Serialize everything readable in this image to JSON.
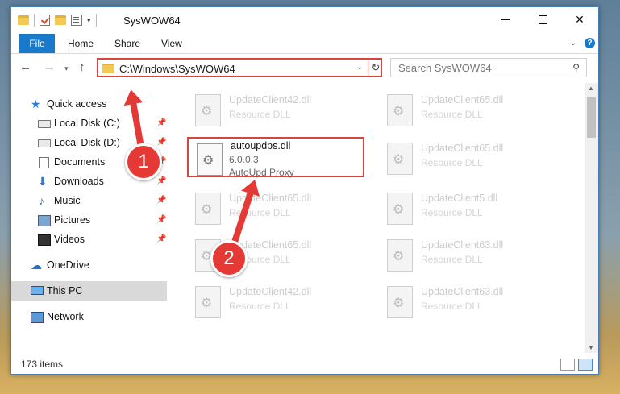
{
  "window": {
    "title": "SysWOW64"
  },
  "ribbon": {
    "tabs": [
      "File",
      "Home",
      "Share",
      "View"
    ]
  },
  "address": {
    "path": "C:\\Windows\\SysWOW64"
  },
  "search": {
    "placeholder": "Search SysWOW64"
  },
  "sidebar": {
    "items": [
      {
        "label": "Quick access",
        "icon": "star-icon",
        "pinned": false
      },
      {
        "label": "Local Disk (C:)",
        "icon": "disk-icon",
        "pinned": true
      },
      {
        "label": "Local Disk (D:)",
        "icon": "disk-icon",
        "pinned": true
      },
      {
        "label": "Documents",
        "icon": "document-icon",
        "pinned": true
      },
      {
        "label": "Downloads",
        "icon": "download-icon",
        "pinned": true
      },
      {
        "label": "Music",
        "icon": "music-icon",
        "pinned": true
      },
      {
        "label": "Pictures",
        "icon": "picture-icon",
        "pinned": true
      },
      {
        "label": "Videos",
        "icon": "video-icon",
        "pinned": true
      },
      {
        "label": "OneDrive",
        "icon": "cloud-icon",
        "pinned": false
      },
      {
        "label": "This PC",
        "icon": "computer-icon",
        "pinned": false,
        "selected": true
      },
      {
        "label": "Network",
        "icon": "network-icon",
        "pinned": false
      }
    ]
  },
  "files": {
    "highlighted": {
      "name": "autoupdps.dll",
      "version": "6.0.0.3",
      "description": "AutoUpd Proxy"
    },
    "left_column": [
      {
        "name": "UpdateClient42.dll",
        "type": "Resource DLL"
      },
      {
        "name": "UpdateClient65.dll",
        "type": "Resource DLL"
      },
      {
        "name": "UpdateClient65.dll",
        "type": "Resource DLL"
      },
      {
        "name": "UpdateClient42.dll",
        "type": "Resource DLL"
      }
    ],
    "right_column": [
      {
        "name": "UpdateClient65.dll",
        "type": "Resource DLL"
      },
      {
        "name": "UpdateClient65.dll",
        "type": "Resource DLL"
      },
      {
        "name": "UpdateClient5.dll",
        "type": "Resource DLL"
      },
      {
        "name": "UpdateClient63.dll",
        "type": "Resource DLL"
      },
      {
        "name": "UpdateClient63.dll",
        "type": "Resource DLL"
      }
    ]
  },
  "status": {
    "item_count": "173 items"
  },
  "callouts": {
    "first": "1",
    "second": "2"
  },
  "colors": {
    "accent": "#1979ca",
    "highlight_red": "#d9453b",
    "arrow_red": "#e53935"
  }
}
